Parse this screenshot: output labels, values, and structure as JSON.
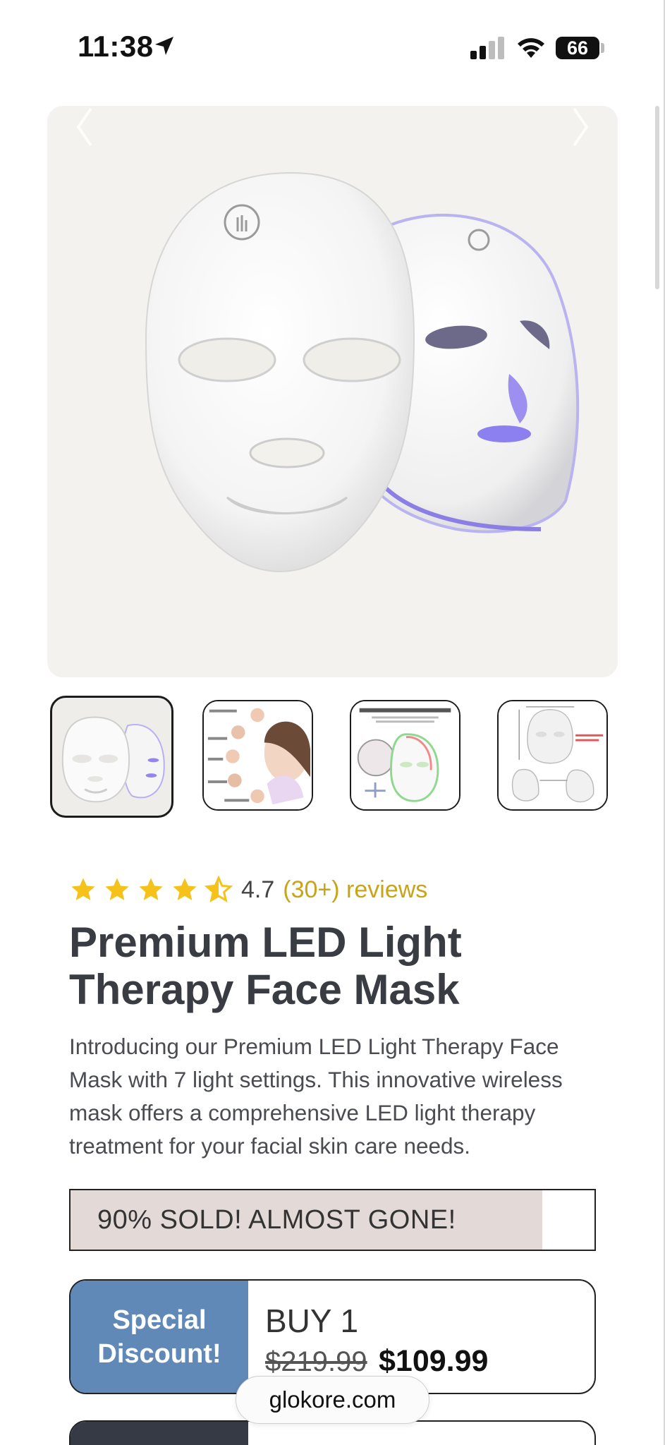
{
  "status_bar": {
    "time": "11:38",
    "battery": "66",
    "icons": [
      "location-arrow-icon",
      "cellular-signal-icon",
      "wifi-icon",
      "battery-icon"
    ]
  },
  "gallery": {
    "hero_alt": "White LED light therapy face mask, front and side view",
    "thumbnails": [
      {
        "name": "mask-front-side",
        "active": true
      },
      {
        "name": "skin-benefits",
        "active": false,
        "captions": [
          "Acne blemish",
          "Whitening skin",
          "Firming skin",
          "Deep repair",
          "Remove wrinkles"
        ]
      },
      {
        "name": "lightweight-comfortable",
        "active": false,
        "heading": "Safe,Lightweight & Comfortable"
      },
      {
        "name": "dimensions",
        "active": false
      }
    ]
  },
  "product": {
    "rating_value": "4.7",
    "rating_stars": 4.5,
    "reviews_text": "(30+) reviews",
    "title": "Premium LED Light Therapy Face Mask",
    "description": "Introducing our Premium LED Light Therapy Face Mask with 7 light settings. This innovative wireless mask offers a comprehensive LED light therapy treatment for your facial skin care needs."
  },
  "stock": {
    "label": "90% SOLD! ALMOST GONE!",
    "sold_fraction": 0.9
  },
  "offers": [
    {
      "badge_line1": "Special",
      "badge_line2": "Discount!",
      "title": "BUY 1",
      "old_price": "$219.99",
      "new_price": "$109.99"
    }
  ],
  "browser": {
    "url": "glokore.com"
  },
  "colors": {
    "star": "#f5c21a",
    "reviews_accent": "#c9a419",
    "badge_blue": "#6089b8",
    "sold_fill": "#e3d9d6",
    "badge_dark": "#363a45"
  }
}
